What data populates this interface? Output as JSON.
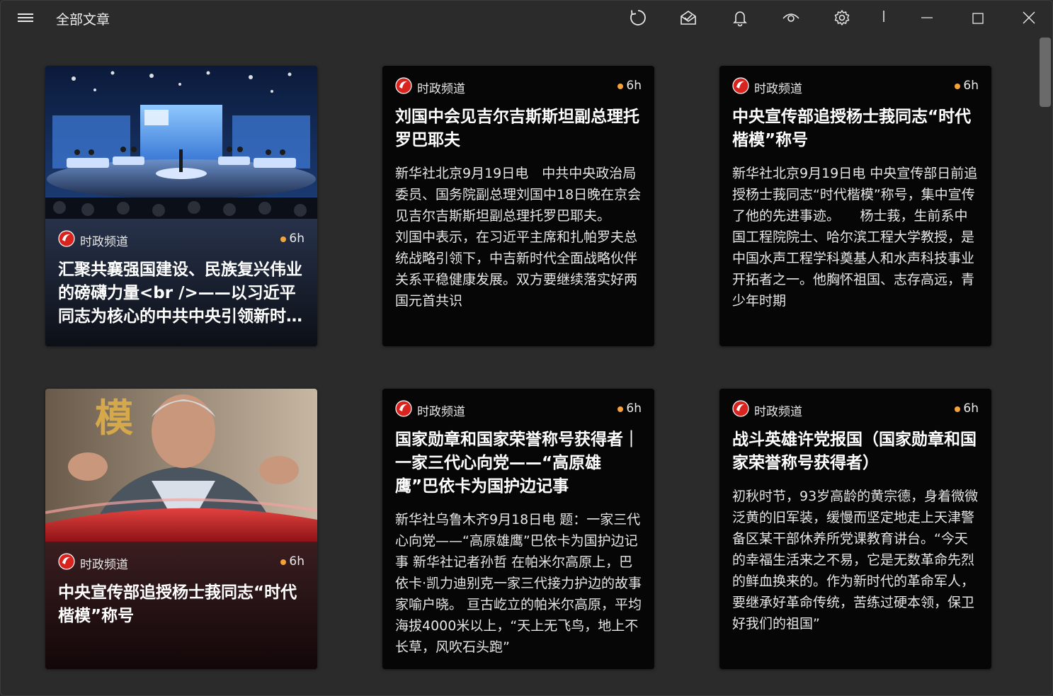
{
  "app": {
    "title": "全部文章"
  },
  "toolbar": {
    "icons": [
      "refresh-icon",
      "read-all-icon",
      "notification-icon",
      "view-icon",
      "settings-icon"
    ],
    "window_controls": [
      "minimize-icon",
      "maximize-icon",
      "close-icon"
    ]
  },
  "colors": {
    "background": "#2b2b2b",
    "card": "#060606",
    "accent_dot": "#f7a13b",
    "logo_red": "#d8231f"
  },
  "cards": [
    {
      "source": "时政频道",
      "time": "6h",
      "headline": "汇聚共襄强国建设、民族复兴伟业的磅礴力量<br />——以习近平同志为核心的中共中央引领新时代统一战线工作纪实",
      "image": "tv-studio-image"
    },
    {
      "source": "时政频道",
      "time": "6h",
      "headline": "刘国中会见吉尔吉斯斯坦副总理托罗巴耶夫",
      "summary": "新华社北京9月19日电　中共中央政治局委员、国务院副总理刘国中18日晚在京会见吉尔吉斯斯坦副总理托罗巴耶夫。　　刘国中表示，在习近平主席和扎帕罗夫总统战略引领下，中吉新时代全面战略伙伴关系平稳健康发展。双方要继续落实好两国元首共识"
    },
    {
      "source": "时政频道",
      "time": "6h",
      "headline": "中央宣传部追授杨士莪同志“时代楷模”称号",
      "summary": "新华社北京9月19日电 中央宣传部日前追授杨士莪同志“时代楷模”称号，集中宣传了他的先进事迹。　　杨士莪，生前系中国工程院院士、哈尔滨工程大学教授，是中国水声工程学科奠基人和水声科技事业开拓者之一。他胸怀祖国、志存高远，青少年时期"
    },
    {
      "source": "时政频道",
      "time": "6h",
      "headline": "中央宣传部追授杨士莪同志“时代楷模”称号",
      "image": "portrait-image",
      "image_text": "模"
    },
    {
      "source": "时政频道",
      "time": "6h",
      "headline": "国家勋章和国家荣誉称号获得者｜一家三代心向党——“高原雄鹰”巴依卡为国护边记事",
      "summary": "新华社乌鲁木齐9月18日电 题：一家三代心向党——“高原雄鹰”巴依卡为国护边记事 新华社记者孙哲 在帕米尔高原上，巴依卡·凯力迪别克一家三代接力护边的故事家喻户晓。 亘古屹立的帕米尔高原，平均海拔4000米以上，“天上无飞鸟，地上不长草，风吹石头跑”"
    },
    {
      "source": "时政频道",
      "time": "6h",
      "headline": "战斗英雄许党报国（国家勋章和国家荣誉称号获得者）",
      "summary": "初秋时节，93岁高龄的黄宗德，身着微微泛黄的旧军装，缓慢而坚定地走上天津警备区某干部休养所党课教育讲台。“今天的幸福生活来之不易，它是无数革命先烈的鲜血换来的。作为新时代的革命军人，要继承好革命传统，苦练过硬本领，保卫好我们的祖国”"
    }
  ]
}
